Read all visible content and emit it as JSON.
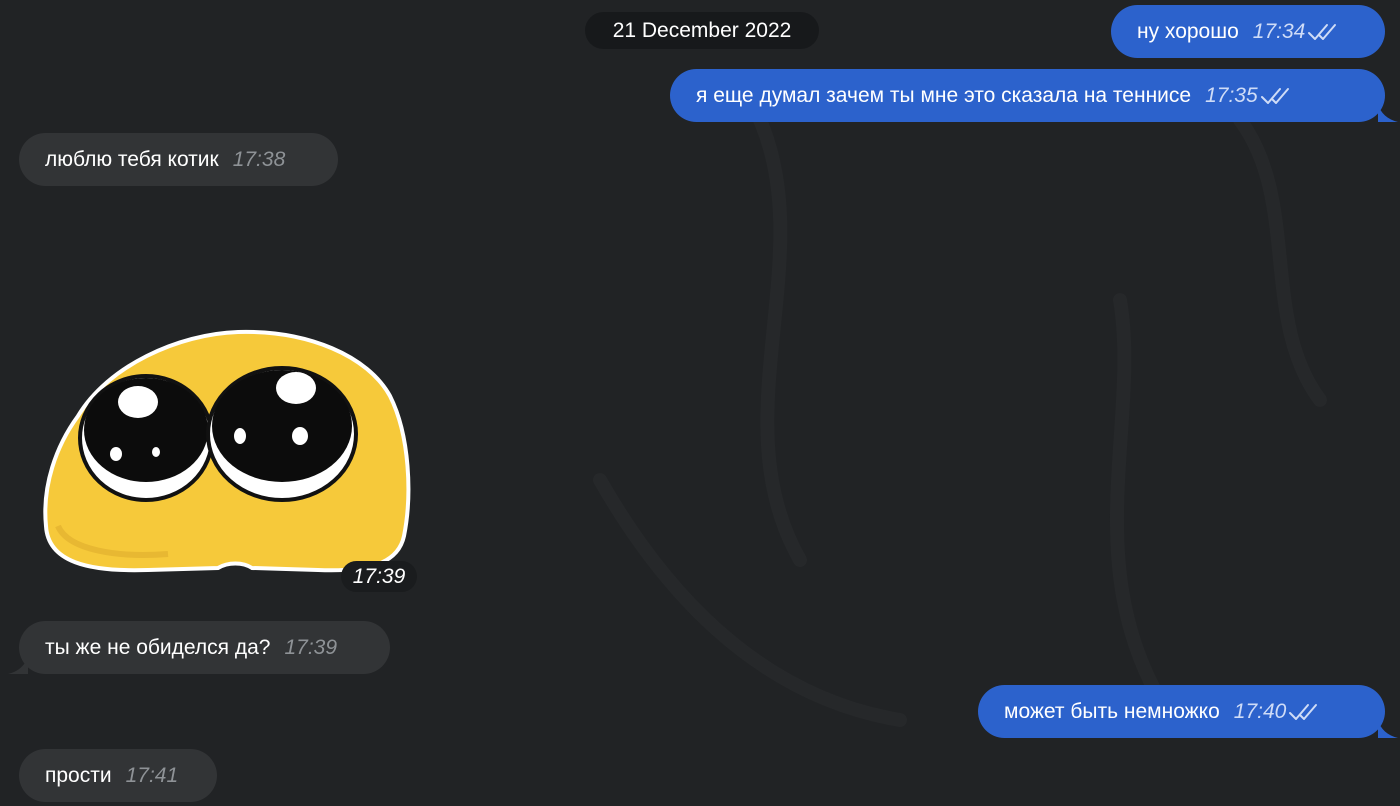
{
  "date_badge": "21 December 2022",
  "messages": [
    {
      "text": "ну хорошо",
      "time": "17:34",
      "direction": "out",
      "status": "read"
    },
    {
      "text": "я еще думал зачем ты мне это сказала на теннисе",
      "time": "17:35",
      "direction": "out",
      "status": "read"
    },
    {
      "text": "люблю тебя котик",
      "time": "17:38",
      "direction": "in"
    },
    {
      "sticker": "crying-emoji-sticker",
      "time": "17:39",
      "direction": "in"
    },
    {
      "text": "ты же не обиделся да?",
      "time": "17:39",
      "direction": "in"
    },
    {
      "text": "может быть немножко",
      "time": "17:40",
      "direction": "out",
      "status": "read"
    },
    {
      "text": "прости",
      "time": "17:41",
      "direction": "in"
    }
  ],
  "colors": {
    "background": "#212325",
    "incoming_bubble": "#323436",
    "outgoing_bubble": "#2c62cc",
    "date_badge": "#17191b"
  },
  "icons": {
    "read_receipt": "double-check-icon"
  }
}
